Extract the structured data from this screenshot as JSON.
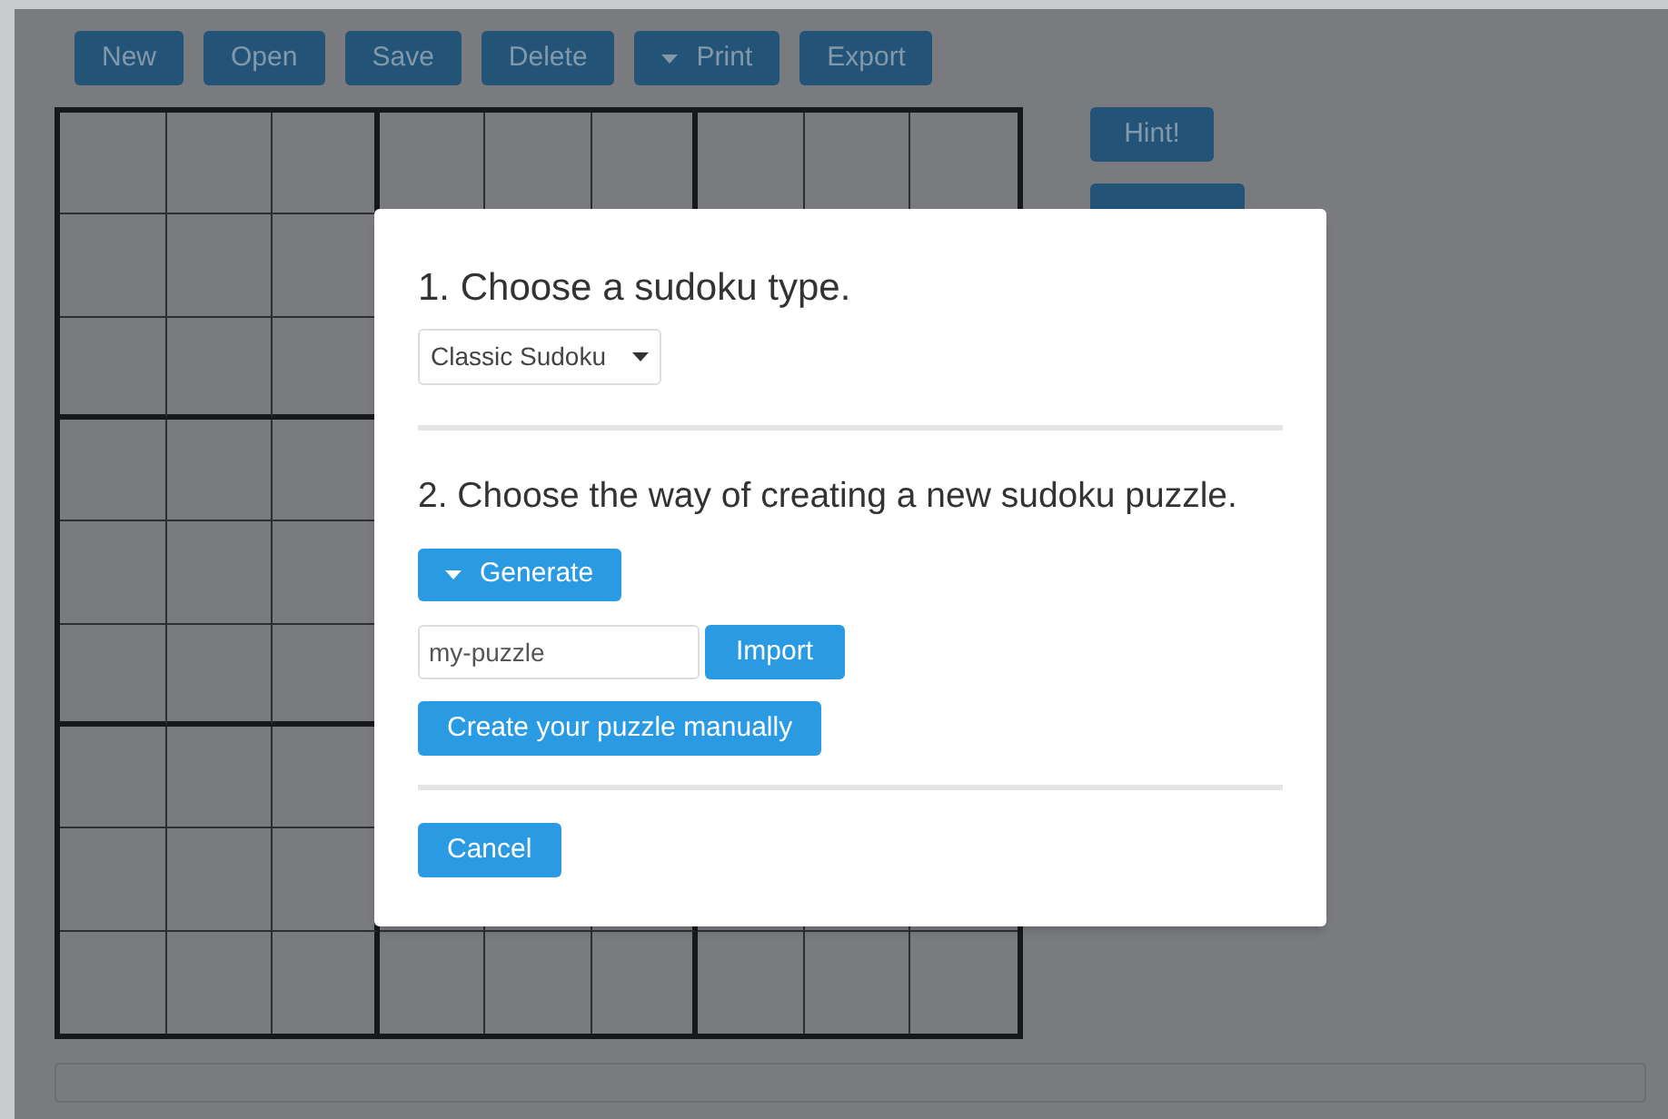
{
  "toolbar": [
    {
      "label": "New",
      "kind": "plain"
    },
    {
      "label": "Open",
      "kind": "plain"
    },
    {
      "label": "Save",
      "kind": "plain"
    },
    {
      "label": "Delete",
      "kind": "plain"
    },
    {
      "label": "Print",
      "kind": "dropdown"
    },
    {
      "label": "Export",
      "kind": "plain"
    }
  ],
  "side_buttons": [
    {
      "label": "Hint!"
    }
  ],
  "dialog": {
    "step1_title": "1. Choose a sudoku type.",
    "type_select": {
      "value": "Classic Sudoku"
    },
    "step2_title": "2. Choose the way of creating a new sudoku puzzle.",
    "generate_button": "Generate",
    "import_field": {
      "value": "my-puzzle"
    },
    "import_button": "Import",
    "manual_button": "Create your puzzle manually",
    "cancel_button": "Cancel"
  }
}
